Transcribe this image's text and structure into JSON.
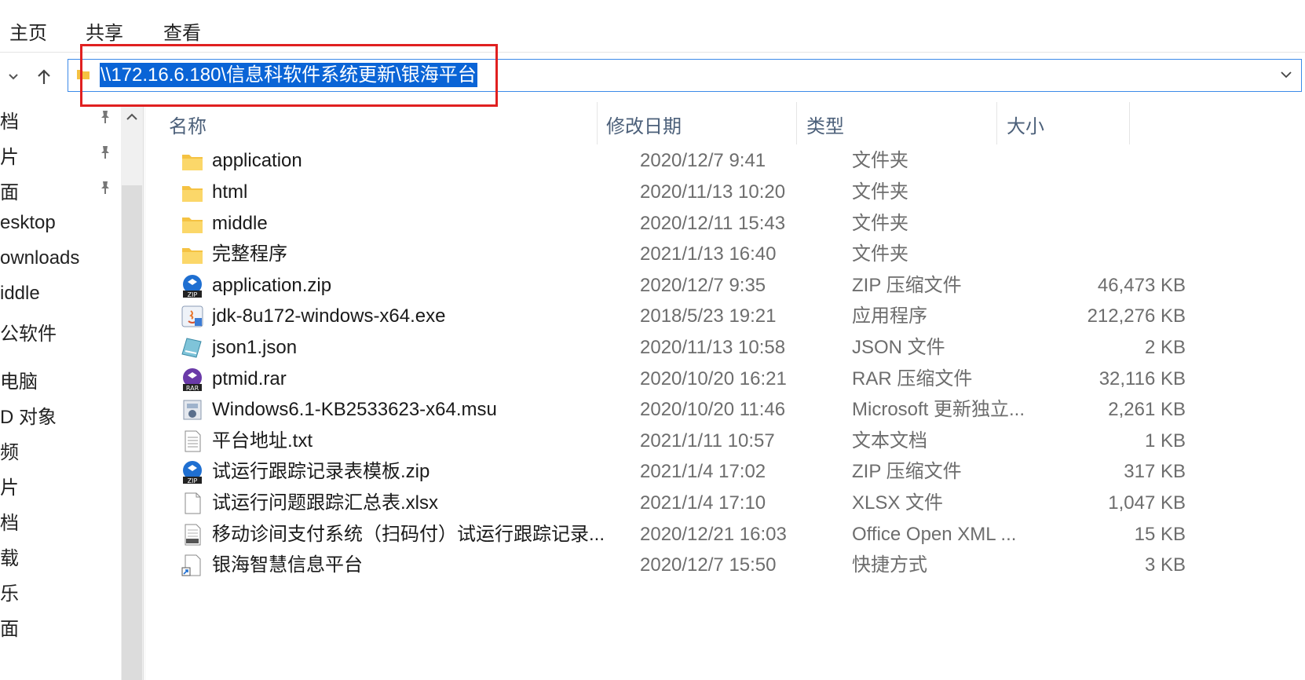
{
  "ribbon": {
    "tabs": [
      "主页",
      "共享",
      "查看"
    ]
  },
  "address_bar": {
    "path": "\\\\172.16.6.180\\信息科软件系统更新\\银海平台",
    "icons": {
      "back": "chevron-down-icon",
      "up": "arrow-up-icon",
      "folder": "folder-icon",
      "dropdown": "chevron-down-icon"
    }
  },
  "nav_pane": {
    "items": [
      {
        "label": "档",
        "pinned": true
      },
      {
        "label": "片",
        "pinned": true
      },
      {
        "label": "面",
        "pinned": true
      },
      {
        "label": "esktop"
      },
      {
        "label": "ownloads"
      },
      {
        "label": "iddle"
      },
      {
        "label": "公软件"
      },
      {
        "label": "电脑"
      },
      {
        "label": "D 对象"
      },
      {
        "label": "频"
      },
      {
        "label": "片"
      },
      {
        "label": "档"
      },
      {
        "label": "载"
      },
      {
        "label": "乐"
      },
      {
        "label": "面"
      }
    ]
  },
  "columns": {
    "name": "名称",
    "date": "修改日期",
    "type": "类型",
    "size": "大小"
  },
  "files": [
    {
      "name": "application",
      "date": "2020/12/7 9:41",
      "type": "文件夹",
      "size": "",
      "icon": "folder-icon"
    },
    {
      "name": "html",
      "date": "2020/11/13 10:20",
      "type": "文件夹",
      "size": "",
      "icon": "folder-icon"
    },
    {
      "name": "middle",
      "date": "2020/12/11 15:43",
      "type": "文件夹",
      "size": "",
      "icon": "folder-icon"
    },
    {
      "name": "完整程序",
      "date": "2021/1/13 16:40",
      "type": "文件夹",
      "size": "",
      "icon": "folder-icon"
    },
    {
      "name": "application.zip",
      "date": "2020/12/7 9:35",
      "type": "ZIP 压缩文件",
      "size": "46,473 KB",
      "icon": "zip-icon"
    },
    {
      "name": "jdk-8u172-windows-x64.exe",
      "date": "2018/5/23 19:21",
      "type": "应用程序",
      "size": "212,276 KB",
      "icon": "java-installer-icon"
    },
    {
      "name": "json1.json",
      "date": "2020/11/13 10:58",
      "type": "JSON 文件",
      "size": "2 KB",
      "icon": "json-file-icon"
    },
    {
      "name": "ptmid.rar",
      "date": "2020/10/20 16:21",
      "type": "RAR 压缩文件",
      "size": "32,116 KB",
      "icon": "rar-icon"
    },
    {
      "name": "Windows6.1-KB2533623-x64.msu",
      "date": "2020/10/20 11:46",
      "type": "Microsoft 更新独立...",
      "size": "2,261 KB",
      "icon": "msu-icon"
    },
    {
      "name": "平台地址.txt",
      "date": "2021/1/11 10:57",
      "type": "文本文档",
      "size": "1 KB",
      "icon": "text-file-icon"
    },
    {
      "name": "试运行跟踪记录表模板.zip",
      "date": "2021/1/4 17:02",
      "type": "ZIP 压缩文件",
      "size": "317 KB",
      "icon": "zip-icon"
    },
    {
      "name": "试运行问题跟踪汇总表.xlsx",
      "date": "2021/1/4 17:10",
      "type": "XLSX 文件",
      "size": "1,047 KB",
      "icon": "blank-file-icon"
    },
    {
      "name": "移动诊间支付系统（扫码付）试运行跟踪记录...",
      "date": "2020/12/21 16:03",
      "type": "Office Open XML ...",
      "size": "15 KB",
      "icon": "docx-icon"
    },
    {
      "name": "银海智慧信息平台",
      "date": "2020/12/7 15:50",
      "type": "快捷方式",
      "size": "3 KB",
      "icon": "shortcut-icon"
    }
  ],
  "colors": {
    "accent": "#0a64d6",
    "highlight": "#e02020",
    "folder": "#f5c242"
  }
}
